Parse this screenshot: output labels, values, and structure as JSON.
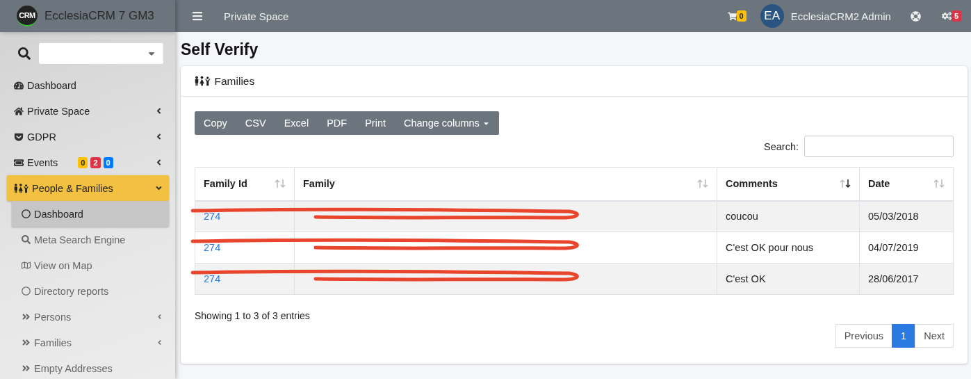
{
  "brand": {
    "logo": "CRM",
    "name": "EcclesiaCRM 7 GM3"
  },
  "topbar": {
    "title": "Private Space",
    "cart_count": "0",
    "user_initials": "EA",
    "user_name": "EcclesiaCRM2 Admin",
    "settings_count": "5"
  },
  "sidebar": {
    "items": [
      {
        "label": "Dashboard",
        "has_submenu": false,
        "selected": false
      },
      {
        "label": "Private Space",
        "has_submenu": true,
        "selected": false
      },
      {
        "label": "GDPR",
        "has_submenu": true,
        "selected": false
      },
      {
        "label": "Events",
        "has_submenu": true,
        "selected": false,
        "badges": [
          {
            "text": "0",
            "color": "#ffc107"
          },
          {
            "text": "2",
            "color": "#dc3545"
          },
          {
            "text": "0",
            "color": "#007bff"
          }
        ]
      },
      {
        "label": "People & Families",
        "has_submenu": true,
        "expanded": true,
        "selected": true,
        "children": [
          {
            "label": "Dashboard",
            "has_submenu": false,
            "selected": true
          },
          {
            "label": "Meta Search Engine",
            "has_submenu": false,
            "selected": false
          },
          {
            "label": "View on Map",
            "has_submenu": false,
            "selected": false
          },
          {
            "label": "Directory reports",
            "has_submenu": false,
            "selected": false
          },
          {
            "label": "Persons",
            "has_submenu": true,
            "selected": false
          },
          {
            "label": "Families",
            "has_submenu": true,
            "selected": false
          },
          {
            "label": "Empty Addresses",
            "has_submenu": false,
            "selected": false
          }
        ]
      }
    ]
  },
  "page_title": "Self Verify",
  "card": {
    "title": "Families",
    "toolbar": [
      {
        "label": "Copy",
        "kind": "button"
      },
      {
        "label": "CSV",
        "kind": "button"
      },
      {
        "label": "Excel",
        "kind": "button"
      },
      {
        "label": "PDF",
        "kind": "button"
      },
      {
        "label": "Print",
        "kind": "button"
      },
      {
        "label": "Change columns",
        "kind": "dropdown"
      }
    ],
    "search": {
      "label": "Search:"
    },
    "table": {
      "columns": [
        {
          "label": "Family Id",
          "sorted": false
        },
        {
          "label": "Family",
          "sorted": false
        },
        {
          "label": "Comments",
          "sorted": true
        },
        {
          "label": "Date",
          "sorted": false
        }
      ],
      "rows": [
        {
          "family_id": "274",
          "family_redacted": true,
          "comments": "coucou",
          "date": "05/03/2018"
        },
        {
          "family_id": "274",
          "family_redacted": true,
          "comments": "C'est OK pour nous",
          "date": "04/07/2019"
        },
        {
          "family_id": "274",
          "family_redacted": true,
          "comments": "C'est OK",
          "date": "28/06/2017"
        }
      ]
    },
    "info": "Showing 1 to 3 of 3 entries",
    "pagination": [
      {
        "label": "Previous",
        "selected": false
      },
      {
        "label": "1",
        "selected": true
      },
      {
        "label": "Next",
        "selected": false
      }
    ]
  }
}
